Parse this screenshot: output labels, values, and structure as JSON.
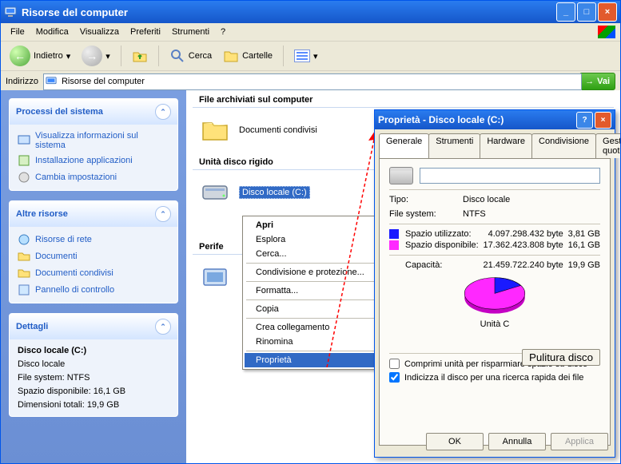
{
  "window": {
    "title": "Risorse del computer",
    "min": "_",
    "max": "□",
    "close": "×"
  },
  "menu": {
    "file": "File",
    "modifica": "Modifica",
    "visualizza": "Visualizza",
    "preferiti": "Preferiti",
    "strumenti": "Strumenti",
    "help": "?"
  },
  "toolbar": {
    "back": "Indietro",
    "search": "Cerca",
    "folders": "Cartelle"
  },
  "address": {
    "label": "Indirizzo",
    "value": "Risorse del computer",
    "go": "Vai",
    "dropdown": "▾"
  },
  "sidebar": {
    "sys": {
      "title": "Processi del sistema",
      "items": [
        "Visualizza informazioni sul sistema",
        "Installazione applicazioni",
        "Cambia impostazioni"
      ]
    },
    "other": {
      "title": "Altre risorse",
      "items": [
        "Risorse di rete",
        "Documenti",
        "Documenti condivisi",
        "Pannello di controllo"
      ]
    },
    "details": {
      "title": "Dettagli",
      "name": "Disco locale (C:)",
      "type": "Disco locale",
      "fs": "File system: NTFS",
      "free": "Spazio disponibile: 16,1 GB",
      "total": "Dimensioni totali: 19,9 GB"
    }
  },
  "content": {
    "sec1": "File archiviati sul computer",
    "item1": "Documenti condivisi",
    "sec2": "Unità disco rigido",
    "item2": "Disco locale (C:)",
    "sec3": "Periferiche"
  },
  "context": {
    "open": "Apri",
    "explore": "Esplora",
    "search": "Cerca...",
    "share": "Condivisione e protezione...",
    "format": "Formatta...",
    "copy": "Copia",
    "shortcut": "Crea collegamento",
    "rename": "Rinomina",
    "props": "Proprietà"
  },
  "dialog": {
    "title": "Proprietà - Disco locale (C:)",
    "help": "?",
    "close": "×",
    "tabs": {
      "general": "Generale",
      "tools": "Strumenti",
      "hardware": "Hardware",
      "sharing": "Condivisione",
      "quota": "Gestione quote"
    },
    "label_value": "",
    "type_lab": "Tipo:",
    "type_val": "Disco locale",
    "fs_lab": "File system:",
    "fs_val": "NTFS",
    "used_lab": "Spazio utilizzato:",
    "used_bytes": "4.097.298.432 byte",
    "used_gb": "3,81 GB",
    "free_lab": "Spazio disponibile:",
    "free_bytes": "17.362.423.808 byte",
    "free_gb": "16,1 GB",
    "cap_lab": "Capacità:",
    "cap_bytes": "21.459.722.240 byte",
    "cap_gb": "19,9 GB",
    "pie_label": "Unità C",
    "cleanup": "Pulitura disco",
    "chk1": "Comprimi unità per risparmiare spazio su disco",
    "chk2": "Indicizza il disco per una ricerca rapida dei file",
    "ok": "OK",
    "cancel": "Annulla",
    "apply": "Applica"
  },
  "chart_data": {
    "type": "pie",
    "title": "Unità C",
    "series": [
      {
        "name": "Spazio utilizzato",
        "value_bytes": 4097298432,
        "value_gb": 3.81,
        "color": "#1a1aff"
      },
      {
        "name": "Spazio disponibile",
        "value_bytes": 17362423808,
        "value_gb": 16.1,
        "color": "#ff28ff"
      }
    ],
    "total_bytes": 21459722240,
    "total_gb": 19.9
  }
}
